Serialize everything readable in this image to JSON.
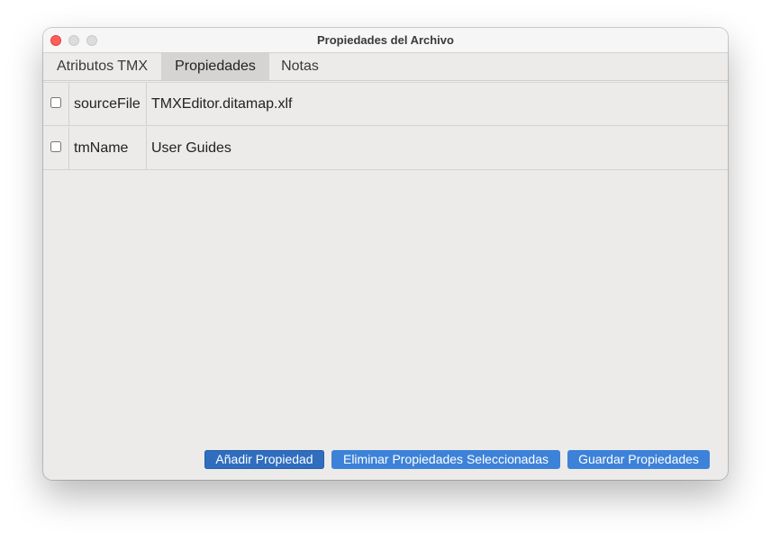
{
  "window": {
    "title": "Propiedades del Archivo"
  },
  "tabs": [
    {
      "label": "Atributos TMX",
      "selected": false
    },
    {
      "label": "Propiedades",
      "selected": true
    },
    {
      "label": "Notas",
      "selected": false
    }
  ],
  "properties": [
    {
      "checked": false,
      "key": "sourceFile",
      "value": "TMXEditor.ditamap.xlf"
    },
    {
      "checked": false,
      "key": "tmName",
      "value": "User Guides"
    }
  ],
  "buttons": {
    "add": "Añadir Propiedad",
    "delete": "Eliminar Propiedades Seleccionadas",
    "save": "Guardar Propiedades"
  },
  "colors": {
    "accent": "#3d82d9",
    "close": "#ff5f57",
    "window_bg": "#ecebea"
  }
}
